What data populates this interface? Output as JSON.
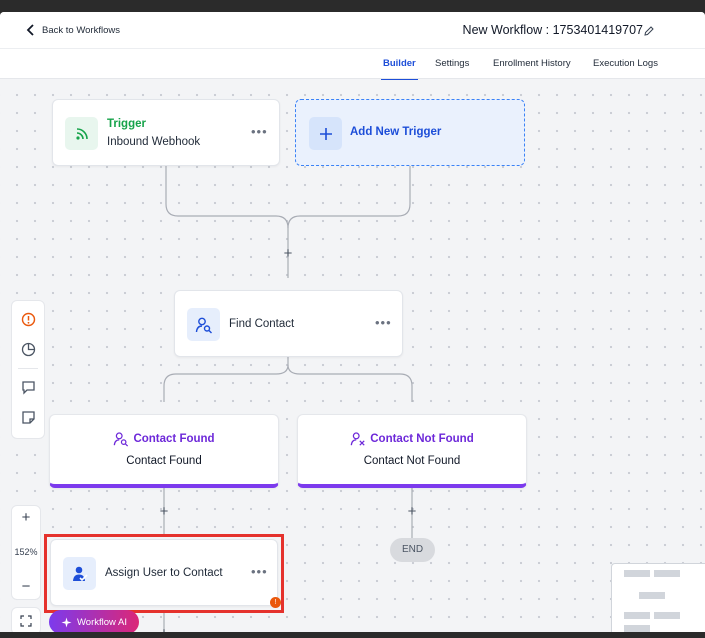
{
  "header": {
    "back_label": "Back to Workflows",
    "workflow_title": "New Workflow : 1753401419707"
  },
  "tabs": [
    "Builder",
    "Settings",
    "Enrollment History",
    "Execution Logs"
  ],
  "active_tab": "Builder",
  "nodes": {
    "trigger": {
      "title": "Trigger",
      "subtitle": "Inbound Webhook",
      "menu": "•••"
    },
    "add_trigger": {
      "label": "Add New Trigger"
    },
    "find_contact": {
      "label": "Find Contact",
      "menu": "•••"
    },
    "branch_found": {
      "title": "Contact Found",
      "subtitle": "Contact Found"
    },
    "branch_not_found": {
      "title": "Contact Not Found",
      "subtitle": "Contact Not Found"
    },
    "assign_user": {
      "label": "Assign User to Contact",
      "menu": "•••",
      "badge": "!"
    },
    "end": {
      "label": "END"
    }
  },
  "plus_symbol": "+",
  "zoom": {
    "level": "152%",
    "plus": "+",
    "minus": "−"
  },
  "workflow_ai": {
    "label": "Workflow AI"
  },
  "colors": {
    "accent": "#1d4ed8",
    "trigger_green": "#16a34a",
    "branch_purple": "#7c3aed",
    "highlight_red": "#e5322d"
  }
}
